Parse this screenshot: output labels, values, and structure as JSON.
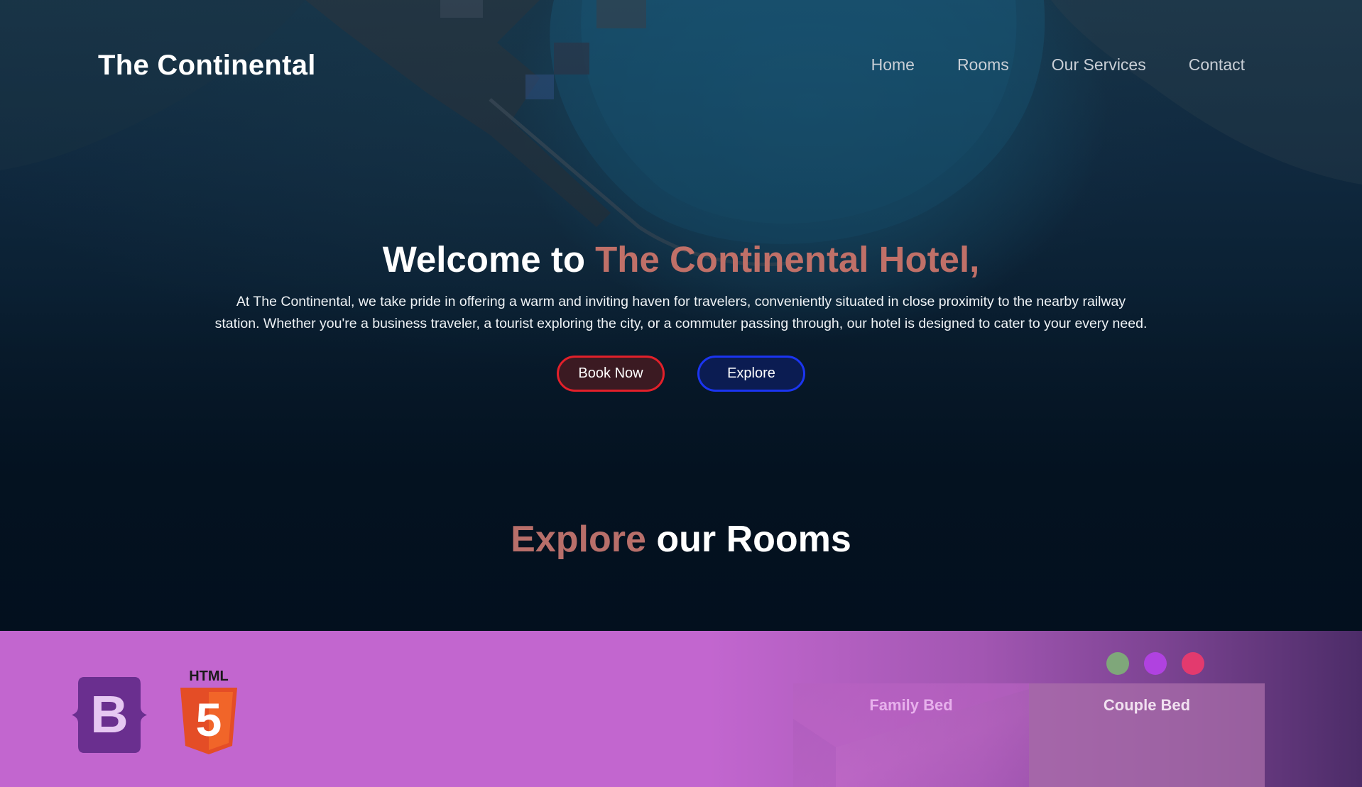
{
  "navbar": {
    "brand": "The Continental",
    "links": [
      "Home",
      "Rooms",
      "Our Services",
      "Contact"
    ]
  },
  "hero": {
    "title_prefix": "Welcome to ",
    "title_accent": "The Continental Hotel,",
    "description": "At The Continental, we take pride in offering a warm and inviting haven for travelers, conveniently situated in close proximity to the nearby railway station. Whether you're a business traveler, a tourist exploring the city, or a commuter passing through, our hotel is designed to cater to your every need.",
    "book_button": "Book Now",
    "explore_button": "Explore"
  },
  "rooms_section": {
    "heading_accent": "Explore",
    "heading_rest": " our Rooms"
  },
  "room_cards": [
    "Family Bed",
    "Couple Bed"
  ],
  "color_dots": [
    "#7fa77a",
    "#b042e0",
    "#e33a6e"
  ],
  "logos": {
    "bootstrap_letter": "B",
    "html5_label": "HTML",
    "html5_number": "5"
  },
  "colors": {
    "accent": "#c07068",
    "book_border": "#e2202a",
    "explore_border": "#1b35f0",
    "footer_bg": "#c266cf"
  },
  "icons": [
    "bootstrap-logo-icon",
    "html5-logo-icon"
  ]
}
